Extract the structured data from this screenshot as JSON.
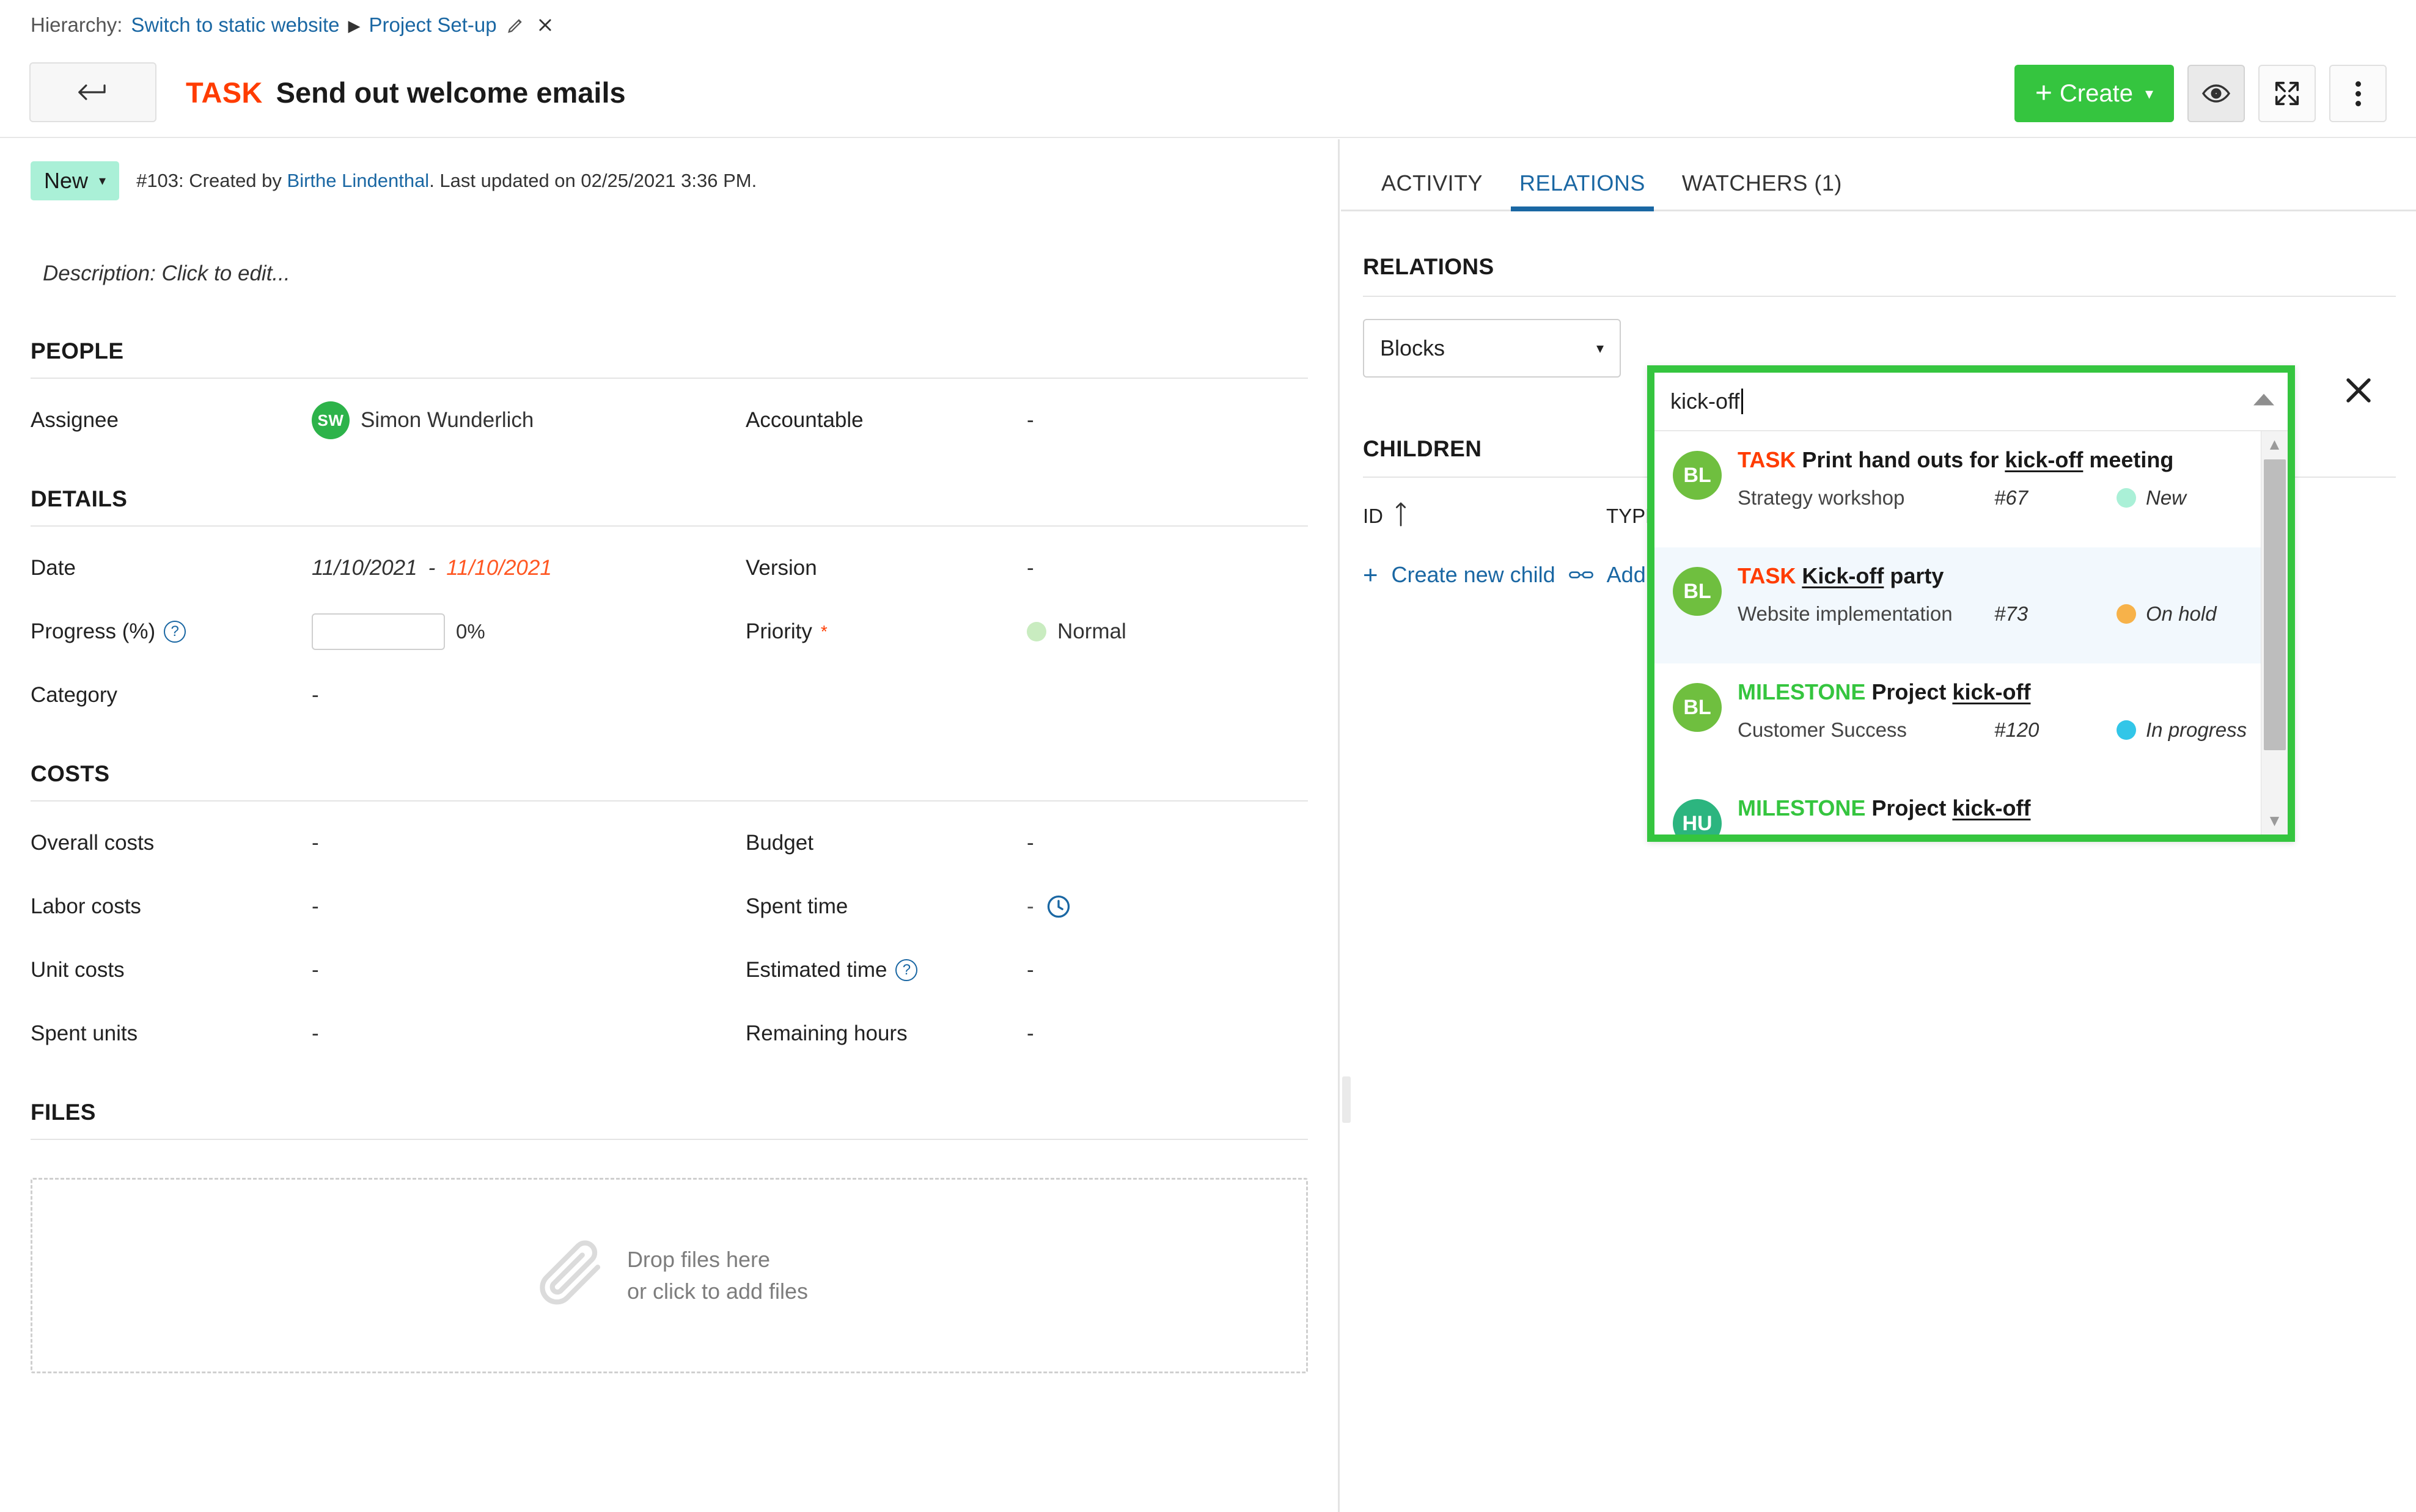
{
  "breadcrumb": {
    "label": "Hierarchy:",
    "root": "Switch to static website",
    "separator": "▶",
    "current": "Project Set-up",
    "edit_icon": "pencil-icon",
    "close_icon": "close-icon"
  },
  "header": {
    "back_icon": "back-arrow-icon",
    "type": "TASK",
    "subject": "Send out welcome emails",
    "create_label": "Create",
    "create_plus": "+",
    "create_caret": "▾",
    "watch_icon": "eye-icon",
    "fullscreen_icon": "fullscreen-icon",
    "more_icon": "more-vertical-icon",
    "accent_green": "#35c53f"
  },
  "status": {
    "label": "New",
    "caret": "▾",
    "meta": "#103: Created by ",
    "author": "Birthe Lindenthal",
    "meta_tail": ". Last updated on 02/25/2021 3:36 PM."
  },
  "description": {
    "placeholder": "Description: Click to edit..."
  },
  "people": {
    "title": "PEOPLE",
    "assignee_label": "Assignee",
    "assignee_initials": "SW",
    "assignee_name": "Simon Wunderlich",
    "accountable_label": "Accountable",
    "accountable_value": "-"
  },
  "details": {
    "title": "DETAILS",
    "date_label": "Date",
    "date_start": "11/10/2021",
    "date_dash": "-",
    "date_end": "11/10/2021",
    "version_label": "Version",
    "version_value": "-",
    "progress_label": "Progress (%)",
    "progress_value": "0%",
    "priority_label": "Priority",
    "priority_required": "*",
    "priority_value": "Normal",
    "priority_color": "#c9ecc0",
    "category_label": "Category",
    "category_value": "-"
  },
  "costs": {
    "title": "COSTS",
    "rows_left": [
      {
        "label": "Overall costs",
        "value": "-"
      },
      {
        "label": "Labor costs",
        "value": "-"
      },
      {
        "label": "Unit costs",
        "value": "-"
      },
      {
        "label": "Spent units",
        "value": "-"
      }
    ],
    "rows_right": [
      {
        "label": "Budget",
        "value": "-"
      },
      {
        "label": "Spent time",
        "value": "-"
      },
      {
        "label": "Estimated time",
        "value": "-"
      },
      {
        "label": "Remaining hours",
        "value": "-"
      }
    ]
  },
  "files": {
    "title": "FILES",
    "drop_line1": "Drop files here",
    "drop_line2": "or click to add files"
  },
  "right": {
    "tabs": [
      {
        "label": "ACTIVITY",
        "active": false
      },
      {
        "label": "RELATIONS",
        "active": true
      },
      {
        "label": "WATCHERS (1)",
        "active": false
      }
    ],
    "relations_title": "RELATIONS",
    "relation_type": "Blocks",
    "relation_caret": "▾",
    "children_title": "CHILDREN",
    "children_col_id": "ID",
    "children_sort_icon": "sort-ascending-icon",
    "children_col_type": "TYPE",
    "create_child_label": "Create new child",
    "create_child_plus": "+",
    "add_existing_label": "Add existing child",
    "add_existing_icon": "link-icon"
  },
  "autocomplete": {
    "query": "kick-off",
    "collapse_icon": "chevron-up-icon",
    "close_icon": "close-icon",
    "border_color": "#35c53f",
    "scroll_up_icon": "▲",
    "scroll_down_icon": "▼",
    "results": [
      {
        "initials": "BL",
        "avatar_color": "#6fbf3f",
        "type": "TASK",
        "type_class": "task",
        "subject_pre": "Print hand outs for ",
        "subject_match": "kick-off",
        "subject_post": " meeting",
        "project": "Strategy workshop",
        "id": "#67",
        "status": "New",
        "status_color": "#aaf0d7",
        "selected": false
      },
      {
        "initials": "BL",
        "avatar_color": "#6fbf3f",
        "type": "TASK",
        "type_class": "task",
        "subject_pre": "",
        "subject_match": "Kick-off",
        "subject_post": " party",
        "project": "Website implementation",
        "id": "#73",
        "status": "On hold",
        "status_color": "#f7b24a",
        "selected": true
      },
      {
        "initials": "BL",
        "avatar_color": "#6fbf3f",
        "type": "MILESTONE",
        "type_class": "milestone",
        "subject_pre": "Project ",
        "subject_match": "kick-off",
        "subject_post": "",
        "project": "Customer Success",
        "id": "#120",
        "status": "In progress",
        "status_color": "#32c6e8",
        "selected": false
      },
      {
        "initials": "HU",
        "avatar_color": "#2cb57f",
        "type": "MILESTONE",
        "type_class": "milestone",
        "subject_pre": "Project ",
        "subject_match": "kick-off",
        "subject_post": "",
        "project": "",
        "id": "",
        "status": "",
        "status_color": "#ffffff",
        "selected": false
      }
    ]
  }
}
